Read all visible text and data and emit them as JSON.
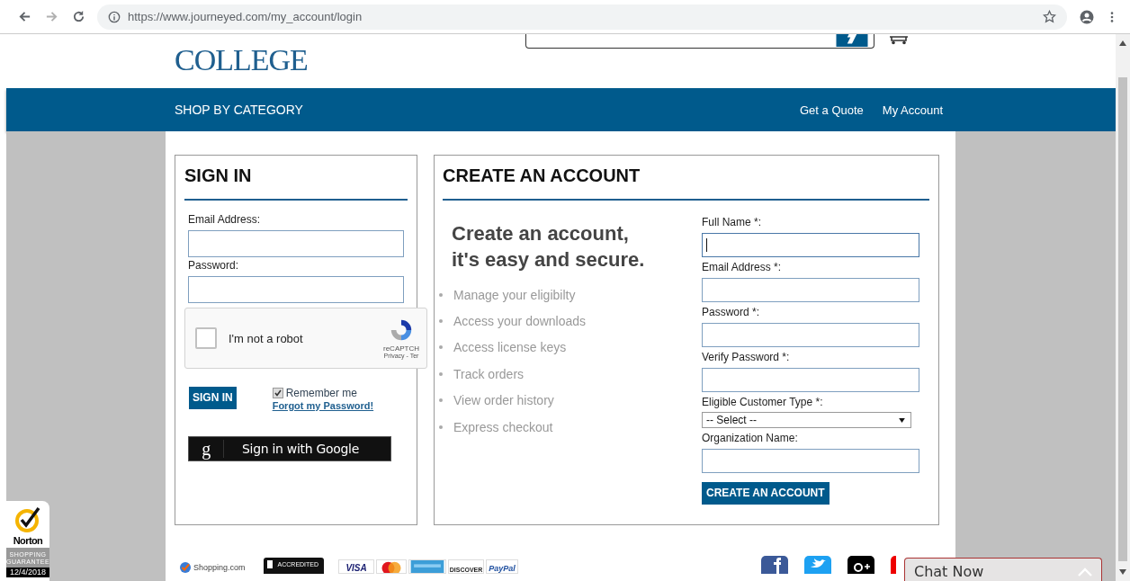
{
  "browser": {
    "url": "https://www.journeyed.com/my_account/login"
  },
  "header": {
    "logo": "COLLEGE"
  },
  "nav": {
    "category": "SHOP BY CATEGORY",
    "links": [
      "Get a Quote",
      "My Account"
    ]
  },
  "sign_in": {
    "title": "SIGN IN",
    "fields": [
      {
        "label": "Email Address:"
      },
      {
        "label": "Password:"
      }
    ],
    "captcha": {
      "label": "I'm not a robot",
      "checked": false,
      "brand": "reCAPTCH",
      "links": "Privacy - Ter"
    },
    "button": "SIGN IN",
    "remember": {
      "label": "Remember me",
      "checked": true
    },
    "forgot": "Forgot my Password!",
    "google": {
      "icon": "g",
      "label": "Sign in with Google"
    }
  },
  "create": {
    "title": "CREATE AN ACCOUNT",
    "tagline": "Create an account, it's easy and secure.",
    "benefits": [
      "Manage your eligibilty",
      "Access your downloads",
      "Access license keys",
      "Track orders",
      "View order history",
      "Express checkout"
    ],
    "fields": [
      {
        "label": "Full Name *:",
        "kind": "text",
        "focused": true
      },
      {
        "label": "Email Address *:",
        "kind": "text",
        "focused": false
      },
      {
        "label": "Password *:",
        "kind": "text",
        "focused": false
      },
      {
        "label": "Verify Password *:",
        "kind": "text",
        "focused": false
      },
      {
        "label": "Eligible Customer Type *:",
        "kind": "select",
        "value": "-- Select --"
      },
      {
        "label": "Organization Name:",
        "kind": "text",
        "focused": false
      }
    ],
    "button": "CREATE AN ACCOUNT"
  },
  "footer": {
    "badges": [
      {
        "kind": "shopping",
        "label": "Shopping.com"
      },
      {
        "kind": "bbb",
        "label": "ACCREDITED"
      }
    ],
    "cards": [
      {
        "kind": "visa",
        "label": "VISA"
      },
      {
        "kind": "mastercard"
      },
      {
        "kind": "amex"
      },
      {
        "kind": "discover",
        "label": "DISCOVER"
      },
      {
        "kind": "paypal",
        "label": "PayPal"
      }
    ],
    "social": [
      {
        "kind": "facebook"
      },
      {
        "kind": "twitter"
      },
      {
        "kind": "googleplus"
      },
      {
        "kind": "youtube"
      }
    ]
  },
  "norton": {
    "brand": "Norton",
    "caption": "SHOPPING GUARANTEE",
    "date": "12/4/2018"
  },
  "chat": {
    "label": "Chat Now"
  }
}
